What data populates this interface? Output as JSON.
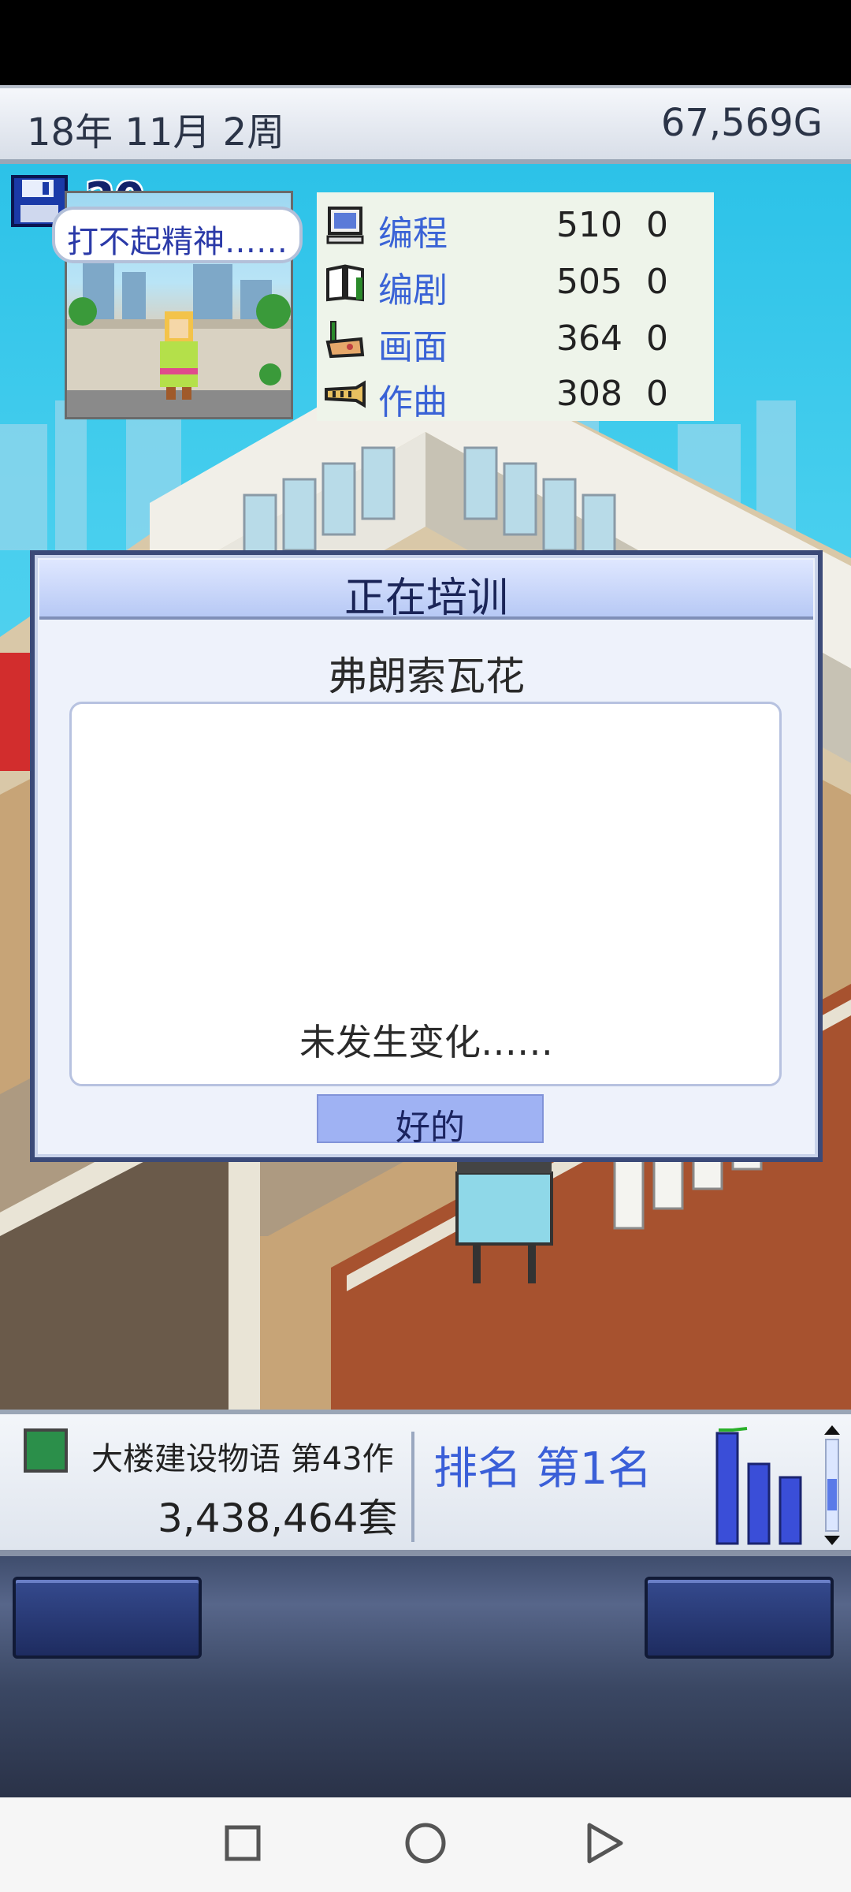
{
  "header": {
    "date": "18年 11月 2周",
    "money": "67,569G"
  },
  "save": {
    "icon": "floppy-disk-icon",
    "count": "20"
  },
  "dialog": {
    "title": "正在培训",
    "employee_name": "弗朗索瓦花",
    "speech": "打不起精神……",
    "stats": [
      {
        "icon": "computer-icon",
        "label": "编程",
        "value": "510",
        "delta": "0"
      },
      {
        "icon": "book-icon",
        "label": "编剧",
        "value": "505",
        "delta": "0"
      },
      {
        "icon": "paint-brush-icon",
        "label": "画面",
        "value": "364",
        "delta": "0"
      },
      {
        "icon": "music-icon",
        "label": "作曲",
        "value": "308",
        "delta": "0"
      }
    ],
    "result": "未发生变化……",
    "ok_label": "好的"
  },
  "bottom": {
    "game_title": "大楼建设物语 第43作",
    "sales": "3,438,464套",
    "rank": "排名 第1名",
    "mini_chart_levels": [
      1.0,
      0.72,
      0.6
    ]
  },
  "colors": {
    "accent": "#3a5fd8",
    "dialog_border": "#3b4a78",
    "sky": "#2cc2e8"
  }
}
